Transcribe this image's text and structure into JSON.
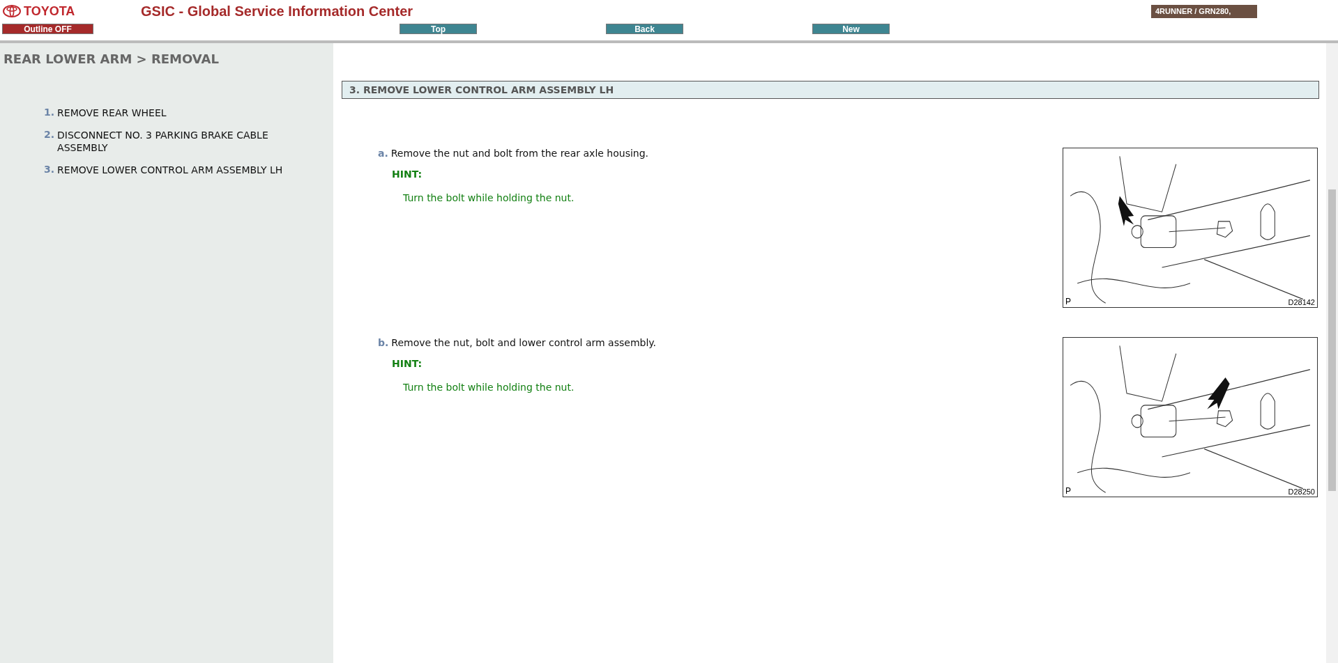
{
  "header": {
    "brand": "TOYOTA",
    "title": "GSIC - Global Service Information Center",
    "vehicle": "4RUNNER / GRN280,",
    "outline_button": "Outline OFF",
    "nav_buttons": [
      "Top",
      "Back",
      "New"
    ]
  },
  "sidebar": {
    "heading": "REAR LOWER ARM > REMOVAL",
    "items": [
      {
        "number": "1.",
        "label": "REMOVE REAR WHEEL"
      },
      {
        "number": "2.",
        "label": "DISCONNECT NO. 3 PARKING BRAKE CABLE ASSEMBLY"
      },
      {
        "number": "3.",
        "label": "REMOVE LOWER CONTROL ARM ASSEMBLY LH"
      }
    ]
  },
  "content": {
    "section_title": "3. REMOVE LOWER CONTROL ARM ASSEMBLY LH",
    "steps": [
      {
        "letter": "a.",
        "text": "Remove the nut and bolt from the rear axle housing.",
        "hint_label": "HINT:",
        "hint": "Turn the bolt while holding the nut.",
        "figure": {
          "corner": "P",
          "code": "D28142"
        }
      },
      {
        "letter": "b.",
        "text": "Remove the nut, bolt and lower control arm assembly.",
        "hint_label": "HINT:",
        "hint": "Turn the bolt while holding the nut.",
        "figure": {
          "corner": "P",
          "code": "D28250"
        }
      }
    ]
  }
}
